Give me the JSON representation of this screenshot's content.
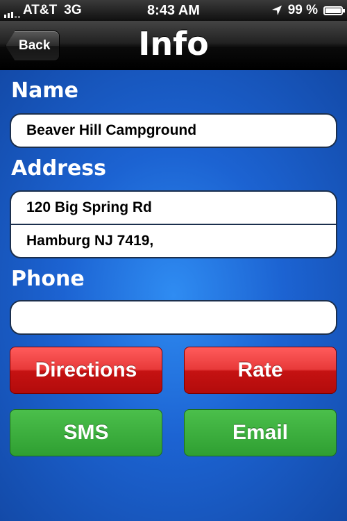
{
  "status_bar": {
    "carrier": "AT&T",
    "network": "3G",
    "time": "8:43 AM",
    "battery_text": "99 %",
    "battery_level": 0.99
  },
  "nav": {
    "back_label": "Back",
    "title": "Info"
  },
  "form": {
    "name_label": "Name",
    "name_value": "Beaver Hill Campground",
    "address_label": "Address",
    "address_line1": "120 Big Spring Rd",
    "address_line2": "Hamburg NJ 7419,",
    "phone_label": "Phone",
    "phone_value": ""
  },
  "actions": {
    "directions": "Directions",
    "rate": "Rate",
    "sms": "SMS",
    "email": "Email"
  },
  "colors": {
    "background": "#1c63d2",
    "button_red": "#d42020",
    "button_green": "#3aab3c"
  }
}
